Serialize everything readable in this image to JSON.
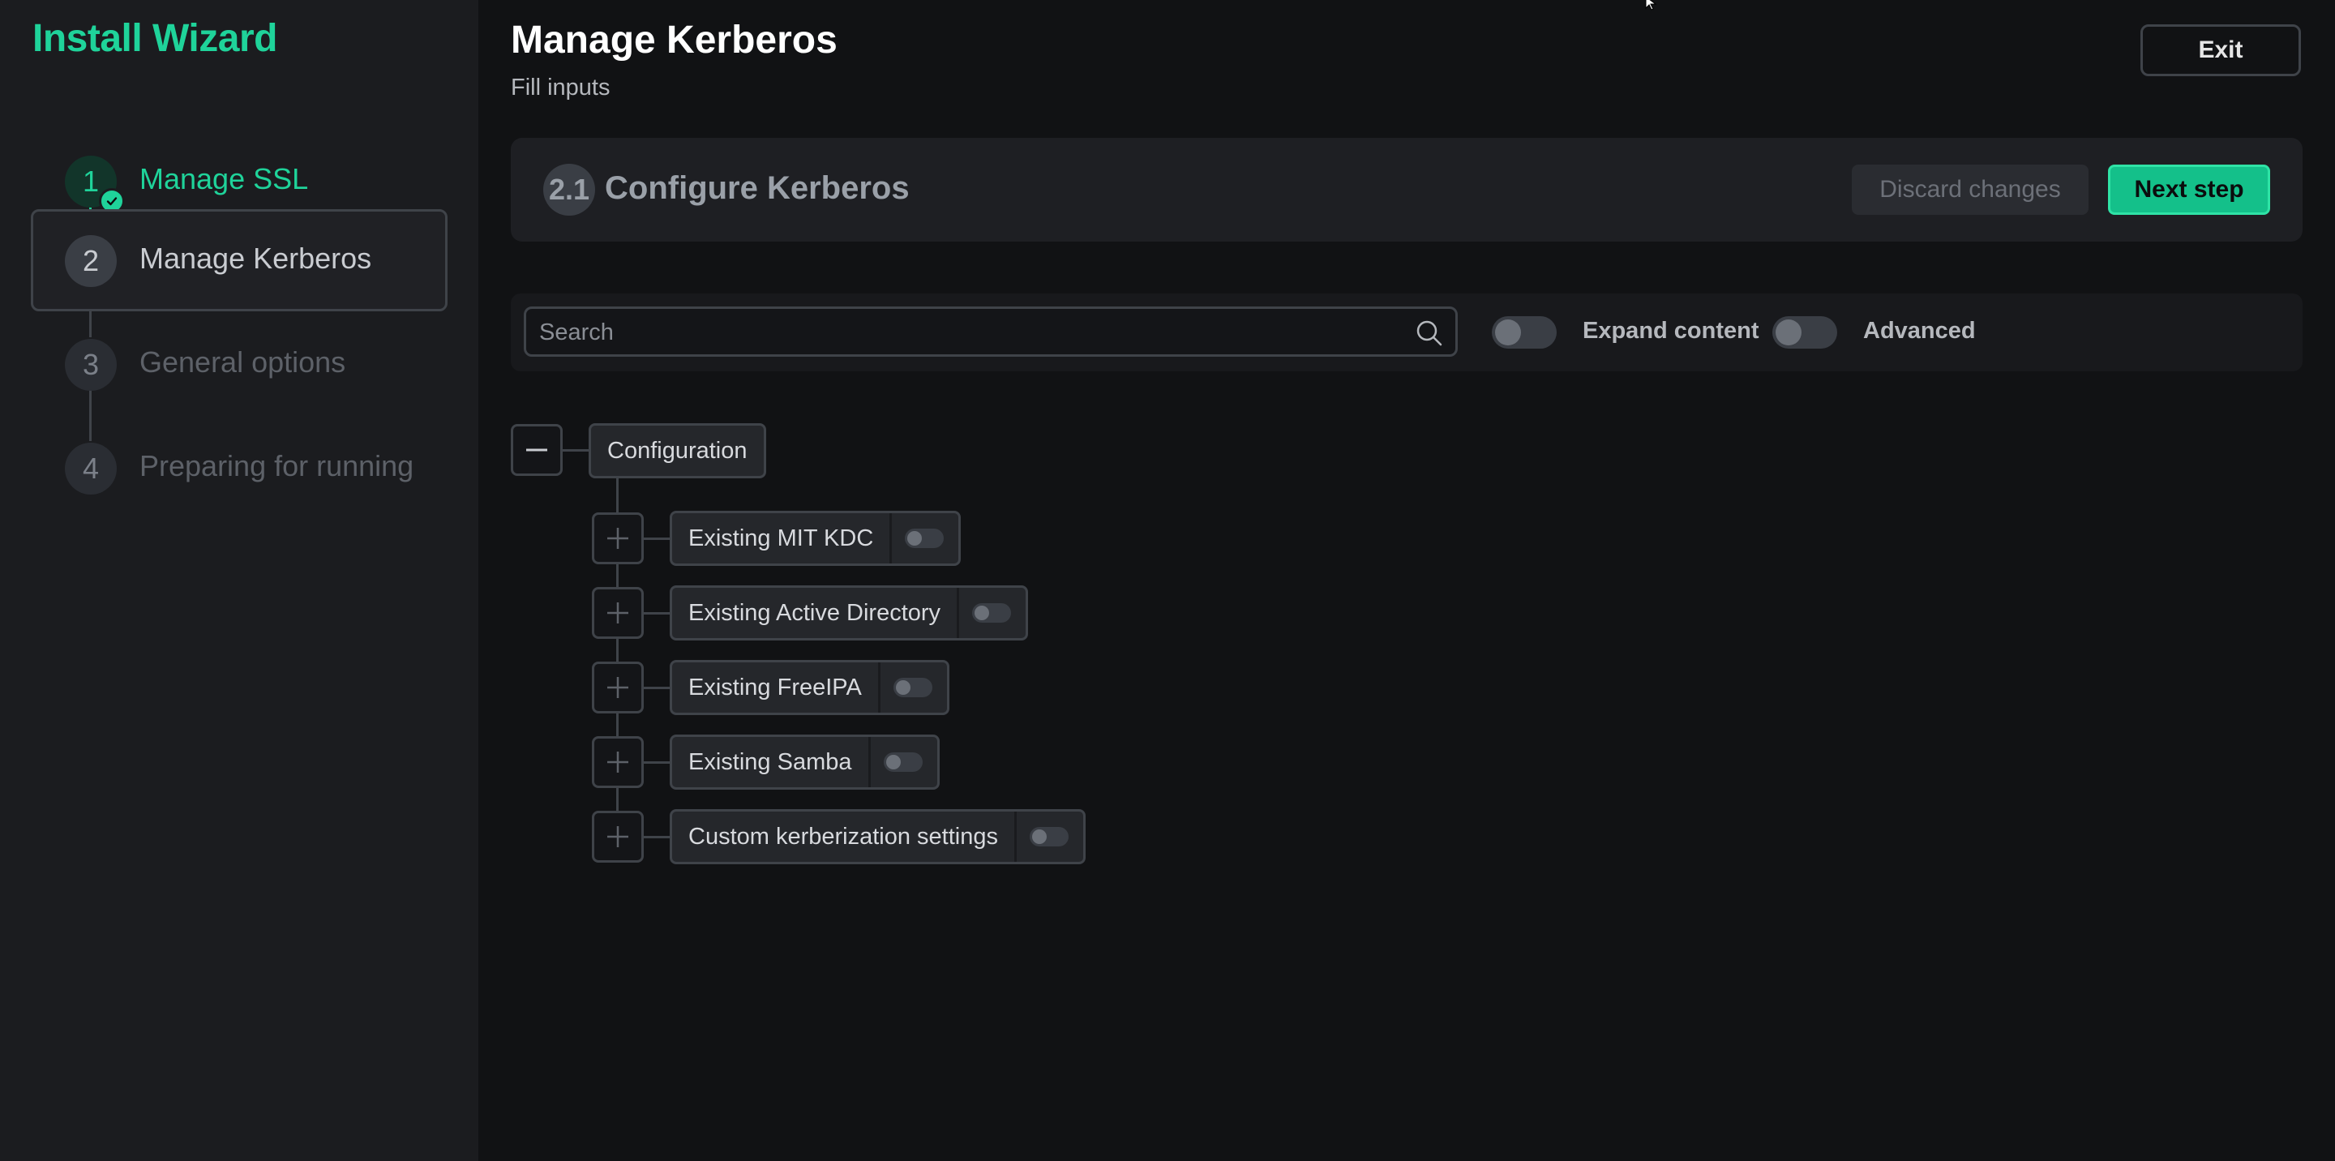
{
  "sidebar": {
    "app_title": "Install Wizard",
    "steps": [
      {
        "number": "1",
        "label": "Manage SSL",
        "state": "done"
      },
      {
        "number": "2",
        "label": "Manage Kerberos",
        "state": "active"
      },
      {
        "number": "3",
        "label": "General options",
        "state": "pending"
      },
      {
        "number": "4",
        "label": "Preparing for running",
        "state": "pending"
      }
    ]
  },
  "header": {
    "title": "Manage Kerberos",
    "subtitle": "Fill inputs",
    "exit_label": "Exit"
  },
  "section": {
    "number": "2.1",
    "title": "Configure Kerberos",
    "discard_label": "Discard changes",
    "next_label": "Next step"
  },
  "toolbar": {
    "search_placeholder": "Search",
    "search_value": "",
    "expand_label": "Expand content",
    "expand_on": false,
    "advanced_label": "Advanced",
    "advanced_on": false
  },
  "tree": {
    "root": {
      "label": "Configuration",
      "expanded": true
    },
    "children": [
      {
        "label": "Existing MIT KDC",
        "enabled": false
      },
      {
        "label": "Existing Active Directory",
        "enabled": false
      },
      {
        "label": "Existing FreeIPA",
        "enabled": false
      },
      {
        "label": "Existing Samba",
        "enabled": false
      },
      {
        "label": "Custom kerberization settings",
        "enabled": false
      }
    ]
  },
  "colors": {
    "accent": "#1fd39a",
    "background": "#111214",
    "sidebar": "#1b1c1f",
    "border": "#3f4349"
  }
}
